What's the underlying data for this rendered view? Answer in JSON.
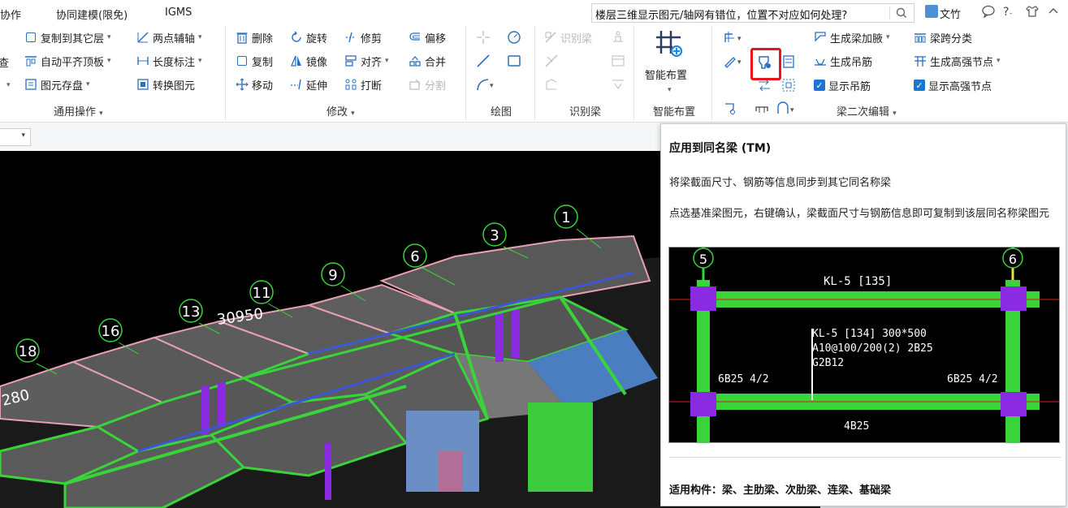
{
  "menu": {
    "items": [
      "协作",
      "协同建模(限免)",
      "IGMS"
    ],
    "help_text": "楼层三维显示图元/轴网有错位，位置不对应如何处理?",
    "user": "文竹"
  },
  "ribbon": {
    "general": {
      "partial_left": [
        "查"
      ],
      "copy_to_floor": "复制到其它层",
      "auto_align": "自动平齐顶板",
      "element_archive": "图元存盘",
      "two_point_axis": "两点辅轴",
      "length_dim": "长度标注",
      "convert_element": "转换图元",
      "label": "通用操作"
    },
    "modify": {
      "delete": "删除",
      "rotate": "旋转",
      "trim": "修剪",
      "offset": "偏移",
      "copy": "复制",
      "mirror": "镜像",
      "align": "对齐",
      "merge": "合并",
      "move": "移动",
      "extend": "延伸",
      "break": "打断",
      "split": "分割",
      "label": "修改"
    },
    "draw": {
      "label": "绘图"
    },
    "identify": {
      "identify_beam": "识别梁",
      "label": "识别梁"
    },
    "smart": {
      "smart_layout": "智能布置",
      "label": "智能布置"
    },
    "beam_edit": {
      "gen_haunch": "生成梁加腋",
      "span_classify": "梁跨分类",
      "gen_hanger": "生成吊筋",
      "gen_strong_node": "生成高强节点",
      "show_hanger": "显示吊筋",
      "show_strong_node": "显示高强节点",
      "label": "梁二次编辑"
    }
  },
  "viewport": {
    "axis_labels": [
      "1",
      "3",
      "6",
      "9",
      "11",
      "13",
      "16",
      "18"
    ],
    "dims": [
      "30950",
      "280"
    ]
  },
  "tooltip": {
    "title": "应用到同名梁 (TM)",
    "desc": "将梁截面尺寸、钢筋等信息同步到其它同名称梁",
    "detail": "点选基准梁图元，右键确认，梁截面尺寸与钢筋信息即可复制到该层同名称梁图元",
    "figure": {
      "axis_left": "5",
      "axis_right": "6",
      "beam_top_label": "KL-5 [135]",
      "beam_line1": "KL-5 [134] 300*500",
      "beam_line2": "A10@100/200(2) 2B25",
      "beam_line3": "G2B12",
      "left_rebar": "6B25 4/2",
      "right_rebar": "6B25 4/2",
      "bottom_rebar": "4B25"
    },
    "applicable": "适用构件：梁、主肋梁、次肋梁、连梁、基础梁"
  },
  "colors": {
    "accent_blue": "#1976d2",
    "highlight_red": "#e5161b",
    "beam_green": "#39d439",
    "column_purple": "#8a2be2"
  }
}
